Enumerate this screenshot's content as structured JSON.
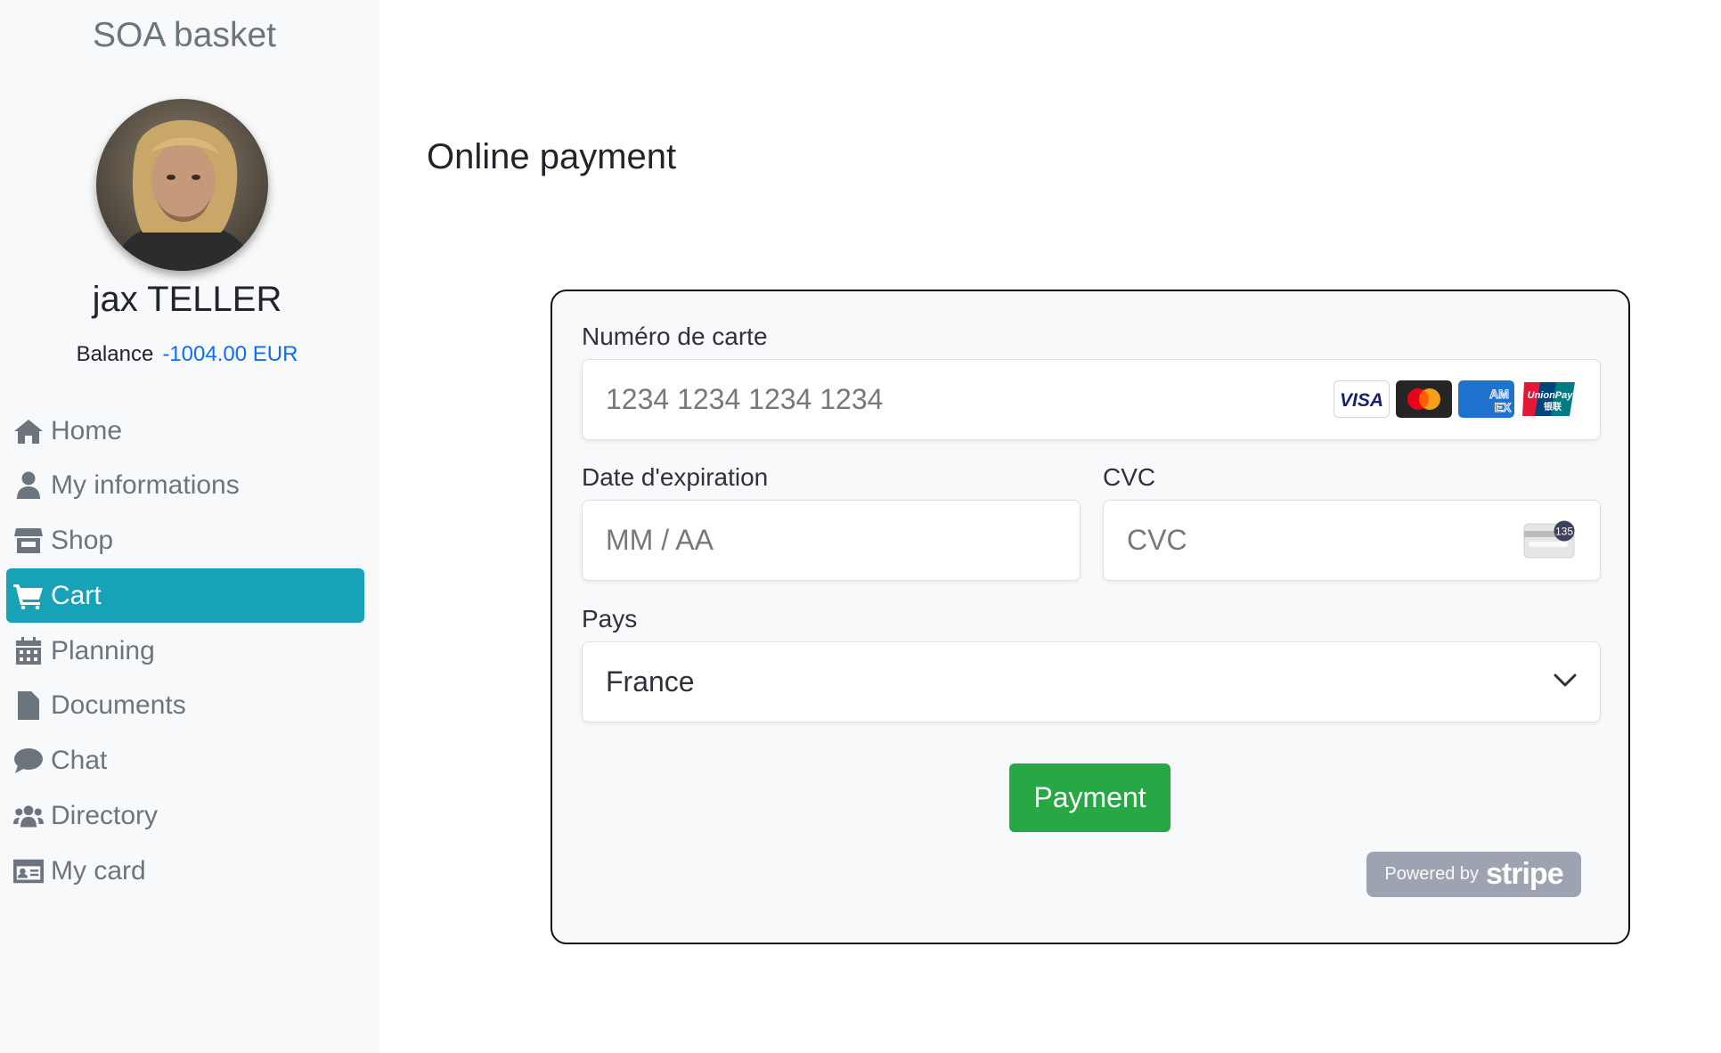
{
  "sidebar": {
    "brand": "SOA basket",
    "user": {
      "name": "jax TELLER",
      "balance_label": "Balance",
      "balance_value": "-1004.00 EUR"
    },
    "nav": [
      {
        "label": "Home",
        "icon": "home-icon",
        "active": false
      },
      {
        "label": "My informations",
        "icon": "user-icon",
        "active": false
      },
      {
        "label": "Shop",
        "icon": "store-icon",
        "active": false
      },
      {
        "label": "Cart",
        "icon": "cart-icon",
        "active": true
      },
      {
        "label": "Planning",
        "icon": "calendar-icon",
        "active": false
      },
      {
        "label": "Documents",
        "icon": "file-icon",
        "active": false
      },
      {
        "label": "Chat",
        "icon": "chat-icon",
        "active": false
      },
      {
        "label": "Directory",
        "icon": "users-icon",
        "active": false
      },
      {
        "label": "My card",
        "icon": "id-card-icon",
        "active": false
      }
    ]
  },
  "main": {
    "title": "Online payment",
    "form": {
      "card_number_label": "Numéro de carte",
      "card_number_placeholder": "1234 1234 1234 1234",
      "card_brands": [
        "VISA",
        "Mastercard",
        "AMEX",
        "UnionPay"
      ],
      "expiry_label": "Date d'expiration",
      "expiry_placeholder": "MM / AA",
      "cvc_label": "CVC",
      "cvc_placeholder": "CVC",
      "cvc_icon_text": "135",
      "country_label": "Pays",
      "country_value": "France",
      "submit_label": "Payment",
      "powered_by": "Powered by",
      "stripe": "stripe"
    }
  },
  "colors": {
    "sidebar_bg": "#f8f9fa",
    "active_nav": "#17a2b8",
    "balance": "#0d6efd",
    "payment_button": "#28a745",
    "stripe_badge": "#9ea3b2"
  }
}
